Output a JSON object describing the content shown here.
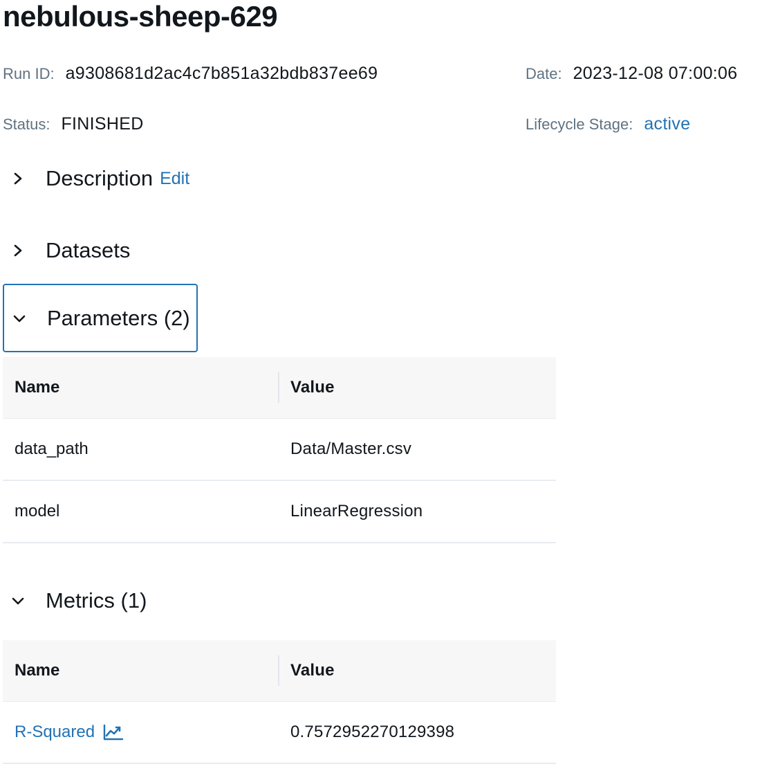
{
  "run": {
    "title": "nebulous-sheep-629",
    "run_id_label": "Run ID:",
    "run_id": "a9308681d2ac4c7b851a32bdb837ee69",
    "date_label": "Date:",
    "date": "2023-12-08 07:00:06",
    "status_label": "Status:",
    "status": "FINISHED",
    "lifecycle_label": "Lifecycle Stage:",
    "lifecycle": "active"
  },
  "sections": {
    "description": {
      "title": "Description",
      "edit_label": "Edit",
      "icon": "chevron-right-icon",
      "expanded": false
    },
    "datasets": {
      "title": "Datasets",
      "icon": "chevron-right-icon",
      "expanded": false
    },
    "parameters": {
      "title": "Parameters (2)",
      "icon": "chevron-down-icon",
      "expanded": true
    },
    "metrics": {
      "title": "Metrics (1)",
      "icon": "chevron-down-icon",
      "expanded": true
    }
  },
  "parameters_table": {
    "headers": {
      "name": "Name",
      "value": "Value"
    },
    "rows": [
      {
        "name": "data_path",
        "value": "Data/Master.csv"
      },
      {
        "name": "model",
        "value": "LinearRegression"
      }
    ]
  },
  "metrics_table": {
    "headers": {
      "name": "Name",
      "value": "Value"
    },
    "rows": [
      {
        "name": "R-Squared",
        "value": "0.7572952270129398",
        "icon": "line-chart-icon"
      }
    ]
  },
  "colors": {
    "text": "#11171c",
    "label": "#5f7281",
    "link": "#2272b4",
    "header_bg": "#f7f7f7",
    "border": "#e8ecf0"
  }
}
